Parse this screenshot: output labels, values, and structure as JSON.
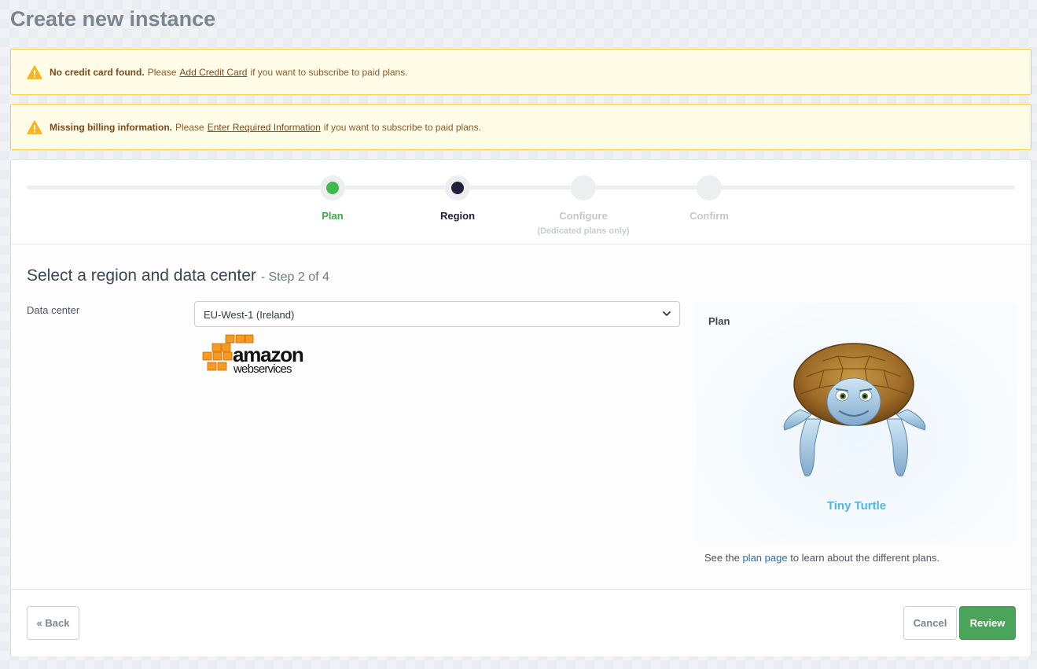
{
  "page": {
    "title": "Create new instance"
  },
  "alerts": {
    "credit": {
      "strong": "No credit card found.",
      "prefix": "Please",
      "link": "Add Credit Card",
      "suffix": "if you want to subscribe to paid plans."
    },
    "billing": {
      "strong": "Missing billing information.",
      "prefix": "Please",
      "link": "Enter Required Information",
      "suffix": "if you want to subscribe to paid plans."
    }
  },
  "wizard": {
    "steps": [
      {
        "label": "Plan",
        "sublabel": ""
      },
      {
        "label": "Region",
        "sublabel": ""
      },
      {
        "label": "Configure",
        "sublabel": "(Dedicated plans only)"
      },
      {
        "label": "Confirm",
        "sublabel": ""
      }
    ]
  },
  "section": {
    "title": "Select a region and data center",
    "step_count": "- Step 2 of 4"
  },
  "form": {
    "data_center": {
      "label": "Data center",
      "value": "EU-West-1 (Ireland)"
    },
    "provider_logo": {
      "line1": "amazon",
      "line2": "webservices"
    }
  },
  "plan": {
    "label": "Plan",
    "name": "Tiny Turtle",
    "note_prefix": "See the",
    "note_link": "plan page",
    "note_suffix": "to learn about the different plans."
  },
  "footer": {
    "back_label": "« Back",
    "cancel_label": "Cancel",
    "review_label": "Review"
  },
  "colors": {
    "success": "#4aa55a",
    "warning_border": "#f3cc4b",
    "active_step": "#22203f",
    "plan_name": "#4db8e8",
    "aws_orange": "#f79a22"
  },
  "icons": {
    "alert": "warning-triangle-icon",
    "select": "chevron-down-icon"
  }
}
